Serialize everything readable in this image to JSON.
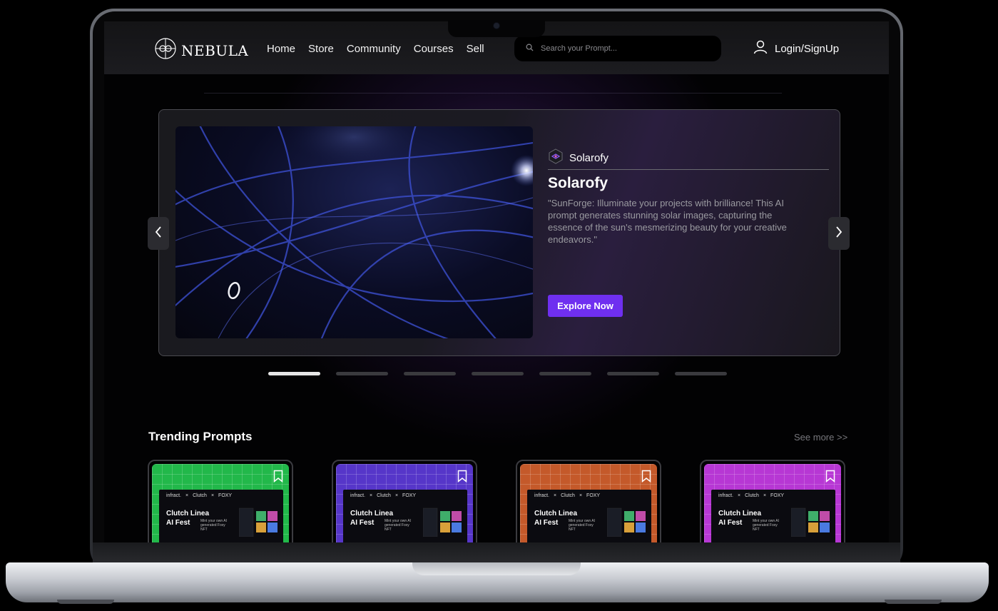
{
  "nav": {
    "brand": "NEBULA",
    "links": [
      "Home",
      "Store",
      "Community",
      "Courses",
      "Sell"
    ],
    "search_placeholder": "Search your Prompt...",
    "login_label": "Login/SignUp"
  },
  "hero": {
    "brand_name": "Solarofy",
    "title": "Solarofy",
    "description": "\"SunForge: Illuminate your projects with brilliance! This AI prompt generates stunning solar images, capturing the essence of the sun's mesmerizing beauty for your creative endeavors.\"",
    "cta_label": "Explore Now",
    "slide_count": 7,
    "active_slide": 1
  },
  "trending": {
    "title": "Trending Prompts",
    "see_more_label": "See more >>",
    "cards": [
      {
        "color": "#22b84a",
        "brands": [
          "infract.",
          "Clutch",
          "FOXY"
        ],
        "title_line1": "Clutch Linea",
        "title_line2": "AI Fest",
        "subtitle": "Mint your own AI generated Foxy NFT"
      },
      {
        "color": "#5636c9",
        "brands": [
          "infract.",
          "Clutch",
          "FOXY"
        ],
        "title_line1": "Clutch Linea",
        "title_line2": "AI Fest",
        "subtitle": "Mint your own AI generated Foxy NFT"
      },
      {
        "color": "#c4592a",
        "brands": [
          "infract.",
          "Clutch",
          "FOXY"
        ],
        "title_line1": "Clutch Linea",
        "title_line2": "AI Fest",
        "subtitle": "Mint your own AI generated Foxy NFT"
      },
      {
        "color": "#b737d4",
        "brands": [
          "infract.",
          "Clutch",
          "FOXY"
        ],
        "title_line1": "Clutch Linea",
        "title_line2": "AI Fest",
        "subtitle": "Mint your own AI generated Foxy NFT"
      }
    ]
  },
  "colors": {
    "accent": "#6f2ff0",
    "background": "#020203",
    "navbar": "#18181b"
  },
  "icons": [
    "nebula-logo-icon",
    "search-icon",
    "user-icon",
    "solarofy-logo-icon",
    "chevron-left-icon",
    "chevron-right-icon",
    "bookmark-icon"
  ]
}
